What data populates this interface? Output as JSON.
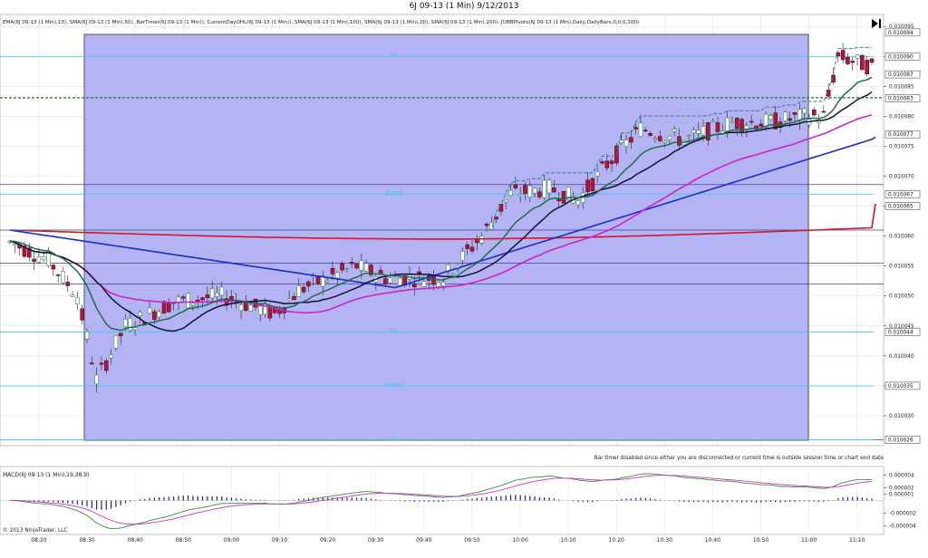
{
  "window": {
    "title": "6J 09-13 (1 Min)  9/12/2013"
  },
  "indicator_line": "EMA(6J 09-13 (1 Min),13), SMA(6J 09-13 (1 Min),50), BarTimer(6J 09-13 (1 Min)), CurrentDayOHL(6J 09-13 (1 Min)), SMA(6J 09-13 (1 Min),100), SMA(6J 09-13 (1 Min),20), SMA(6J 09-13 (1 Min),200), JOBBPivots(6J 09-13 (1 Min),Daily,DailyBars,0,0,0,100)",
  "bar_timer_message": "Bar timer disabled since either you are disconnected or current time is outside session time or chart end date",
  "macd_label": "MACD(6J 09-13 (1 Min),19,38,9)",
  "copyright": "© 2013 NinjaTrader, LLC",
  "colors": {
    "background": "#ffffff",
    "session_shade": "#b4b4f5",
    "up_candle": "#3c8c50",
    "down_candle": "#b4143c",
    "ema13": "#1e6e46",
    "sma20": "#111133",
    "sma50": "#cc22cc",
    "sma100": "#1a2ecc",
    "sma200": "#cc1a2a",
    "pivot": "#44c8ee",
    "current_day": "#3a7a8a",
    "prior_level": "#1a7a1a",
    "macd": "#3c8c3c",
    "macd_avg": "#cc33cc",
    "macd_hist": "#222266"
  },
  "chart_data": [
    {
      "type": "candlestick",
      "title": "6J 09-13 (1 Min)  9/12/2013",
      "x_tick_labels": [
        "08:20",
        "08:30",
        "08:40",
        "08:50",
        "09:00",
        "09:10",
        "09:20",
        "09:30",
        "09:40",
        "09:50",
        "10:00",
        "10:10",
        "10:20",
        "10:30",
        "10:40",
        "10:50",
        "11:00",
        "11:10"
      ],
      "y_tick_labels": [
        "0.010095",
        "0.010090",
        "0.010085",
        "0.010080",
        "0.010075",
        "0.010070",
        "0.010065",
        "0.010060",
        "0.010055",
        "0.010050",
        "0.010045",
        "0.010040",
        "0.010035",
        "0.010030"
      ],
      "ylim": [
        0.010025,
        0.010097
      ],
      "price_tags": [
        "0.010094",
        "0.010090",
        "0.010087",
        "0.010083",
        "0.010077",
        "0.010067",
        "0.010065",
        "0.010044",
        "0.010035",
        "0.010026"
      ],
      "pivot_lines": [
        {
          "label": "R3",
          "value": 0.01009
        },
        {
          "label": "R2Mid",
          "value": 0.010067
        },
        {
          "label": "R2",
          "value": 0.010044
        },
        {
          "label": "R1Mid",
          "value": 0.010035
        },
        {
          "label": "R1",
          "value": 0.010026
        }
      ],
      "reference_levels": [
        0.0100831,
        0.0100686,
        0.010061,
        0.0100555,
        0.010052,
        0.010026
      ],
      "series": [
        {
          "name": "EMA 13",
          "color_key": "ema13"
        },
        {
          "name": "SMA 20",
          "color_key": "sma20"
        },
        {
          "name": "SMA 50",
          "color_key": "sma50"
        },
        {
          "name": "SMA 100",
          "color_key": "sma100"
        },
        {
          "name": "SMA 200",
          "color_key": "sma200"
        }
      ],
      "grid": true
    },
    {
      "type": "line",
      "title": "MACD(6J 09-13 (1 Min),19,38,9)",
      "y_tick_labels": [
        "0.000004",
        "0.000002",
        "0.000001",
        "-0.000002",
        "-0.000004"
      ],
      "ylim": [
        -5.2e-06,
        5.2e-06
      ],
      "series": [
        {
          "name": "MACD",
          "color_key": "macd"
        },
        {
          "name": "Avg",
          "color_key": "macd_avg"
        },
        {
          "name": "Diff",
          "color_key": "macd_hist"
        }
      ]
    }
  ]
}
